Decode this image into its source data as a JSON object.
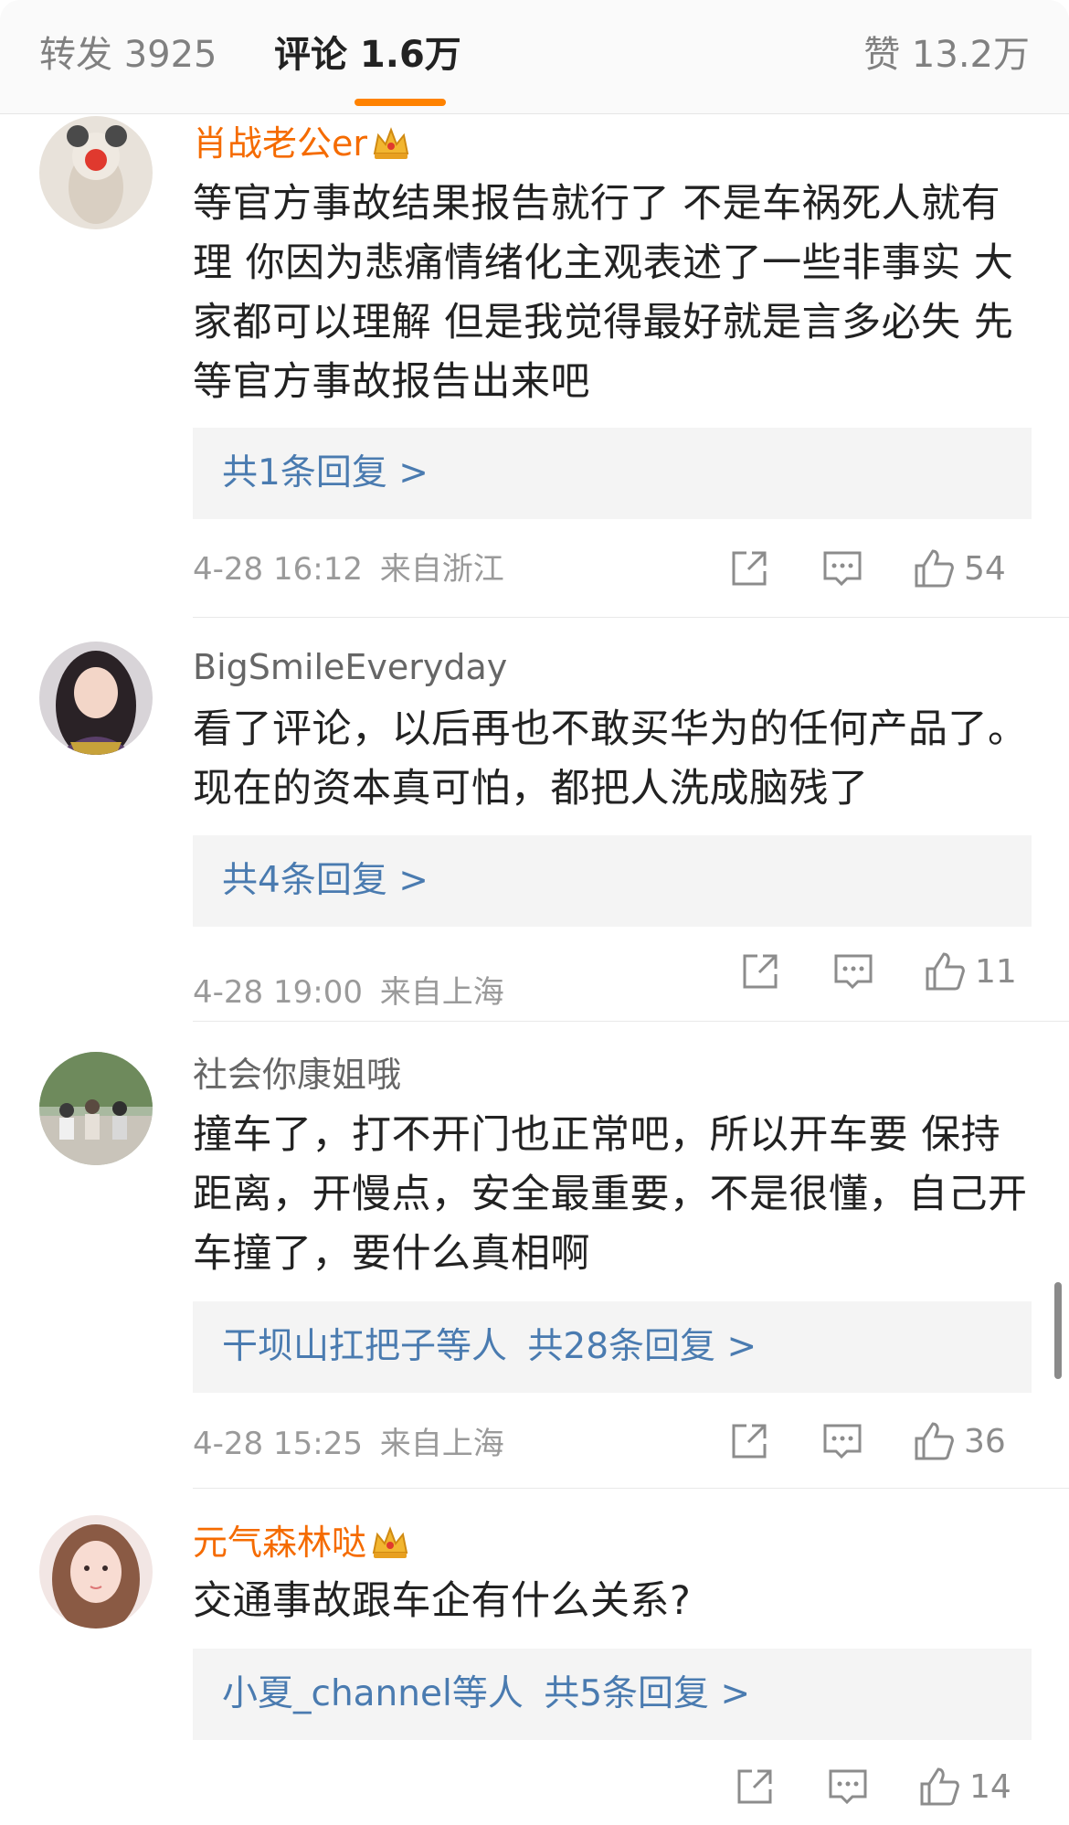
{
  "tabs": {
    "repost": "转发 3925",
    "comments": "评论 1.6万",
    "likes": "赞 13.2万"
  },
  "comments": [
    {
      "username": "肖战老公er",
      "vip": true,
      "text": "等官方事故结果报告就行了  不是车祸死人就有理 你因为悲痛情绪化主观表述了一些非事实 大家都可以理解 但是我觉得最好就是言多必失 先等官方事故报告出来吧",
      "reply_names": "",
      "reply_count": "共1条回复 >",
      "time": "4-28 16:12",
      "location": "来自浙江",
      "likes": "54"
    },
    {
      "username": "BigSmileEveryday",
      "vip": false,
      "text": "看了评论，以后再也不敢买华为的任何产品了。现在的资本真可怕，都把人洗成脑残了",
      "reply_names": "",
      "reply_count": "共4条回复 >",
      "time": "4-28 19:00",
      "location": "来自上海",
      "likes": "11"
    },
    {
      "username": "社会你康姐哦",
      "vip": false,
      "text": "撞车了，打不开门也正常吧，所以开车要 保持距离，开慢点，安全最重要，不是很懂，自己开车撞了，要什么真相啊",
      "reply_names": "干坝山扛把子等人",
      "reply_count": "共28条回复 >",
      "time": "4-28 15:25",
      "location": "来自上海",
      "likes": "36"
    },
    {
      "username": "元气森林哒",
      "vip": true,
      "text": "交通事故跟车企有什么关系?",
      "reply_names": "小夏_channel等人",
      "reply_count": "共5条回复 >",
      "time": "",
      "location": "",
      "likes": "14"
    }
  ],
  "icons": {
    "share": "share-icon",
    "comment": "comment-icon",
    "like": "thumbs-up-icon",
    "vip": "crown-icon"
  },
  "colors": {
    "accent": "#ff8200",
    "vip_name": "#f56b00",
    "link": "#4a7bb0"
  }
}
